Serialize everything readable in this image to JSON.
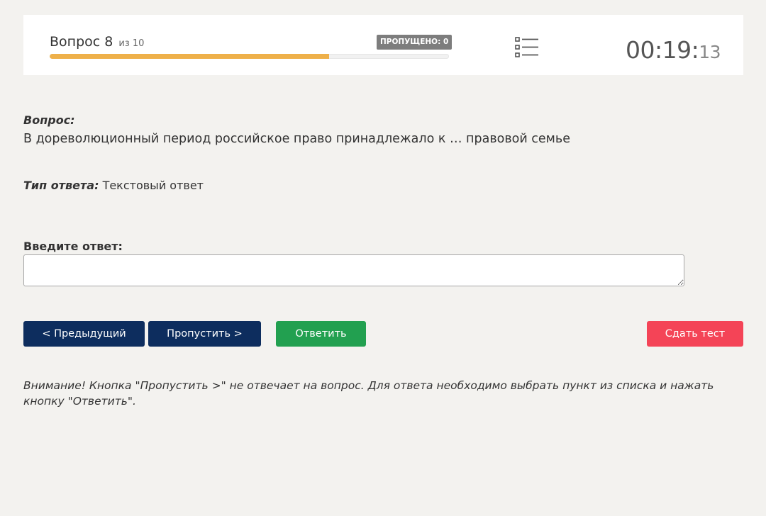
{
  "header": {
    "question_label": "Вопрос 8",
    "question_of": "из 10",
    "skipped_badge": "ПРОПУЩЕНО: 0",
    "progress": 0.7,
    "timer_main": "00:19:",
    "timer_seconds": "13"
  },
  "question": {
    "label": "Вопрос:",
    "text": "В дореволюционный период российское право принадлежало к … правовой семье"
  },
  "answer_type": {
    "label": "Тип ответа:",
    "value": "Текстовый ответ"
  },
  "answer": {
    "label": "Введите ответ:",
    "value": ""
  },
  "buttons": {
    "prev": "< Предыдущий",
    "skip": "Пропустить >",
    "answer": "Ответить",
    "submit": "Сдать тест"
  },
  "notice": "Внимание! Кнопка \"Пропустить >\" не отвечает на вопрос. Для ответа необходимо выбрать пункт из списка и нажать кнопку \"Ответить\".",
  "colors": {
    "progress_fill": "#eeb04a",
    "nav_button": "#0d2d5e",
    "answer_button": "#22a050",
    "submit_button": "#f44457",
    "badge": "#7d7d7d"
  },
  "icons": {
    "question_list": "list-icon"
  }
}
